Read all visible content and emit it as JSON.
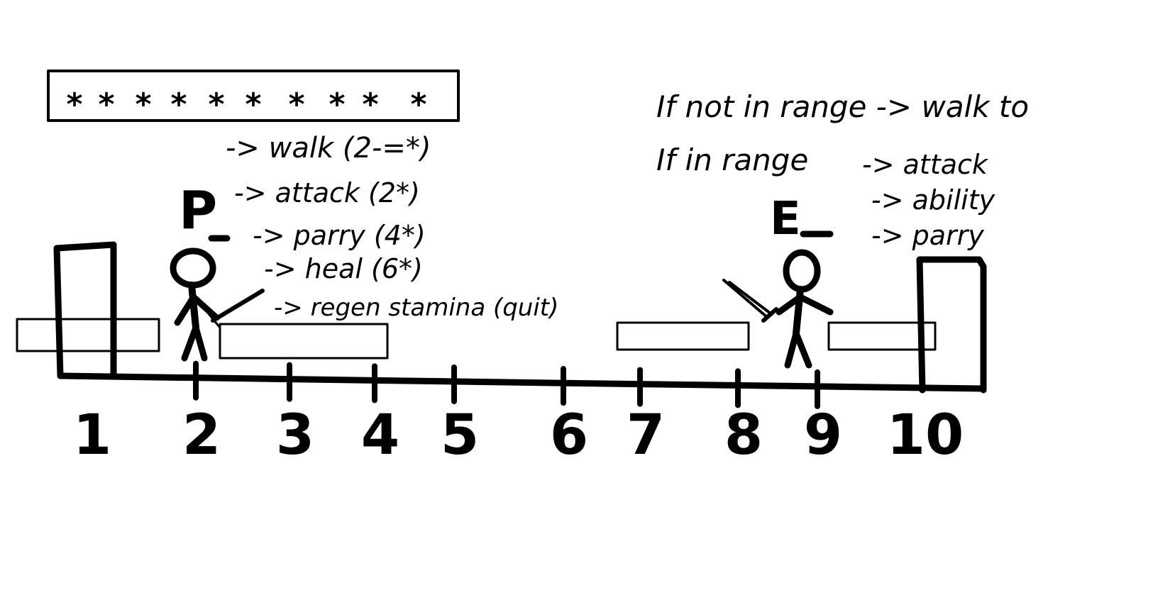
{
  "stamina_bar": {
    "stars": [
      "*",
      "*",
      "*",
      "*",
      "*",
      "*",
      "*",
      "*",
      "*",
      "*"
    ]
  },
  "player": {
    "label": "P",
    "actions": [
      "-> walk (2-=*)",
      "-> attack (2*)",
      "-> parry (4*)",
      "-> heal (6*)",
      "-> regen stamina (quit)"
    ]
  },
  "enemy": {
    "label": "E",
    "rule_not_in_range": "If not in range -> walk to",
    "rule_in_range": "If in range",
    "actions": [
      "-> attack",
      "-> ability",
      "-> parry"
    ]
  },
  "track": {
    "positions": [
      "1",
      "2",
      "3",
      "4",
      "5",
      "6",
      "7",
      "8",
      "9",
      "10"
    ]
  }
}
